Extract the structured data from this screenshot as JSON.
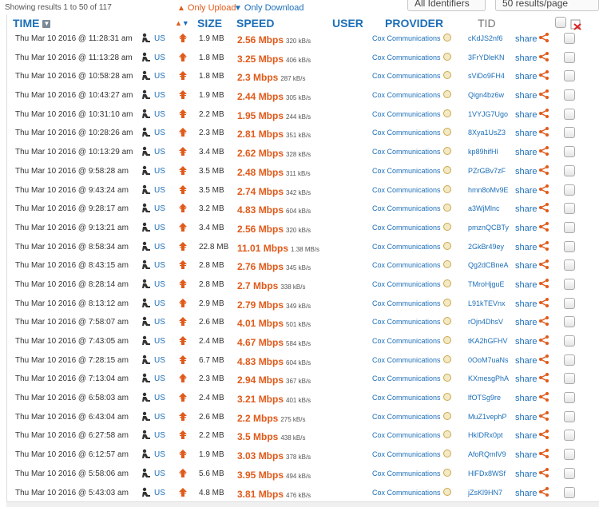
{
  "top": {
    "showing": "Showing results 1 to 50 of 117",
    "only_upload": "Only Upload",
    "only_download": "Only Download",
    "select_provider": "All Identifiers",
    "select_page": "50 results/page"
  },
  "header": {
    "time": "TIME",
    "size": "SIZE",
    "speed": "SPEED",
    "user": "USER",
    "provider": "PROVIDER",
    "tid": "TID"
  },
  "colors": {
    "accent_blue": "#1d6fb8",
    "accent_orange": "#e05a1a"
  },
  "rows": [
    {
      "time": "Thu Mar 10 2016 @ 11:28:31 am",
      "country": "US",
      "size": "1.9 MB",
      "mbps": "2.56 Mbps",
      "kbs": "320 kB/s",
      "provider": "Cox Communications",
      "tid": "cKdJS2nf6",
      "share": "share"
    },
    {
      "time": "Thu Mar 10 2016 @ 11:13:28 am",
      "country": "US",
      "size": "1.8 MB",
      "mbps": "3.25 Mbps",
      "kbs": "406 kB/s",
      "provider": "Cox Communications",
      "tid": "3FrYDleKN",
      "share": "share"
    },
    {
      "time": "Thu Mar 10 2016 @ 10:58:28 am",
      "country": "US",
      "size": "1.8 MB",
      "mbps": "2.3 Mbps",
      "kbs": "287 kB/s",
      "provider": "Cox Communications",
      "tid": "sViDo9FH4",
      "share": "share"
    },
    {
      "time": "Thu Mar 10 2016 @ 10:43:27 am",
      "country": "US",
      "size": "1.9 MB",
      "mbps": "2.44 Mbps",
      "kbs": "305 kB/s",
      "provider": "Cox Communications",
      "tid": "Qign4bz6w",
      "share": "share"
    },
    {
      "time": "Thu Mar 10 2016 @ 10:31:10 am",
      "country": "US",
      "size": "2.2 MB",
      "mbps": "1.95 Mbps",
      "kbs": "244 kB/s",
      "provider": "Cox Communications",
      "tid": "1VYJG7Ugo",
      "share": "share"
    },
    {
      "time": "Thu Mar 10 2016 @ 10:28:26 am",
      "country": "US",
      "size": "2.3 MB",
      "mbps": "2.81 Mbps",
      "kbs": "351 kB/s",
      "provider": "Cox Communications",
      "tid": "8Xya1UsZ3",
      "share": "share"
    },
    {
      "time": "Thu Mar 10 2016 @ 10:13:29 am",
      "country": "US",
      "size": "3.4 MB",
      "mbps": "2.62 Mbps",
      "kbs": "328 kB/s",
      "provider": "Cox Communications",
      "tid": "kp89hifHl",
      "share": "share"
    },
    {
      "time": "Thu Mar 10 2016 @ 9:58:28 am",
      "country": "US",
      "size": "3.5 MB",
      "mbps": "2.48 Mbps",
      "kbs": "311 kB/s",
      "provider": "Cox Communications",
      "tid": "PZrGBv7zF",
      "share": "share"
    },
    {
      "time": "Thu Mar 10 2016 @ 9:43:24 am",
      "country": "US",
      "size": "3.5 MB",
      "mbps": "2.74 Mbps",
      "kbs": "342 kB/s",
      "provider": "Cox Communications",
      "tid": "hmn8oMv9E",
      "share": "share"
    },
    {
      "time": "Thu Mar 10 2016 @ 9:28:17 am",
      "country": "US",
      "size": "3.2 MB",
      "mbps": "4.83 Mbps",
      "kbs": "604 kB/s",
      "provider": "Cox Communications",
      "tid": "a3WjMlnc",
      "share": "share"
    },
    {
      "time": "Thu Mar 10 2016 @ 9:13:21 am",
      "country": "US",
      "size": "3.4 MB",
      "mbps": "2.56 Mbps",
      "kbs": "320 kB/s",
      "provider": "Cox Communications",
      "tid": "pmznQCBTy",
      "share": "share"
    },
    {
      "time": "Thu Mar 10 2016 @ 8:58:34 am",
      "country": "US",
      "size": "22.8 MB",
      "mbps": "11.01 Mbps",
      "kbs": "1.38 MB/s",
      "provider": "Cox Communications",
      "tid": "2GkBr49ey",
      "share": "share"
    },
    {
      "time": "Thu Mar 10 2016 @ 8:43:15 am",
      "country": "US",
      "size": "2.8 MB",
      "mbps": "2.76 Mbps",
      "kbs": "345 kB/s",
      "provider": "Cox Communications",
      "tid": "Qg2dCBneA",
      "share": "share"
    },
    {
      "time": "Thu Mar 10 2016 @ 8:28:14 am",
      "country": "US",
      "size": "2.8 MB",
      "mbps": "2.7 Mbps",
      "kbs": "338 kB/s",
      "provider": "Cox Communications",
      "tid": "TMroHjguE",
      "share": "share"
    },
    {
      "time": "Thu Mar 10 2016 @ 8:13:12 am",
      "country": "US",
      "size": "2.9 MB",
      "mbps": "2.79 Mbps",
      "kbs": "349 kB/s",
      "provider": "Cox Communications",
      "tid": "L91kTEVnx",
      "share": "share"
    },
    {
      "time": "Thu Mar 10 2016 @ 7:58:07 am",
      "country": "US",
      "size": "2.6 MB",
      "mbps": "4.01 Mbps",
      "kbs": "501 kB/s",
      "provider": "Cox Communications",
      "tid": "rOjn4DhsV",
      "share": "share"
    },
    {
      "time": "Thu Mar 10 2016 @ 7:43:05 am",
      "country": "US",
      "size": "2.4 MB",
      "mbps": "4.67 Mbps",
      "kbs": "584 kB/s",
      "provider": "Cox Communications",
      "tid": "tKA2hGFHV",
      "share": "share"
    },
    {
      "time": "Thu Mar 10 2016 @ 7:28:15 am",
      "country": "US",
      "size": "6.7 MB",
      "mbps": "4.83 Mbps",
      "kbs": "604 kB/s",
      "provider": "Cox Communications",
      "tid": "0OoM7uaNs",
      "share": "share"
    },
    {
      "time": "Thu Mar 10 2016 @ 7:13:04 am",
      "country": "US",
      "size": "2.3 MB",
      "mbps": "2.94 Mbps",
      "kbs": "367 kB/s",
      "provider": "Cox Communications",
      "tid": "KXmesgPhA",
      "share": "share"
    },
    {
      "time": "Thu Mar 10 2016 @ 6:58:03 am",
      "country": "US",
      "size": "2.4 MB",
      "mbps": "3.21 Mbps",
      "kbs": "401 kB/s",
      "provider": "Cox Communications",
      "tid": "lfOTSg9re",
      "share": "share"
    },
    {
      "time": "Thu Mar 10 2016 @ 6:43:04 am",
      "country": "US",
      "size": "2.6 MB",
      "mbps": "2.2 Mbps",
      "kbs": "275 kB/s",
      "provider": "Cox Communications",
      "tid": "MuZ1vephP",
      "share": "share"
    },
    {
      "time": "Thu Mar 10 2016 @ 6:27:58 am",
      "country": "US",
      "size": "2.2 MB",
      "mbps": "3.5 Mbps",
      "kbs": "438 kB/s",
      "provider": "Cox Communications",
      "tid": "HkIDRx0pt",
      "share": "share"
    },
    {
      "time": "Thu Mar 10 2016 @ 6:12:57 am",
      "country": "US",
      "size": "1.9 MB",
      "mbps": "3.03 Mbps",
      "kbs": "378 kB/s",
      "provider": "Cox Communications",
      "tid": "AfoRQmlV9",
      "share": "share"
    },
    {
      "time": "Thu Mar 10 2016 @ 5:58:06 am",
      "country": "US",
      "size": "5.6 MB",
      "mbps": "3.95 Mbps",
      "kbs": "494 kB/s",
      "provider": "Cox Communications",
      "tid": "HlFDx8WSf",
      "share": "share"
    },
    {
      "time": "Thu Mar 10 2016 @ 5:43:03 am",
      "country": "US",
      "size": "4.8 MB",
      "mbps": "3.81 Mbps",
      "kbs": "476 kB/s",
      "provider": "Cox Communications",
      "tid": "jZsKl9HN7",
      "share": "share"
    }
  ]
}
